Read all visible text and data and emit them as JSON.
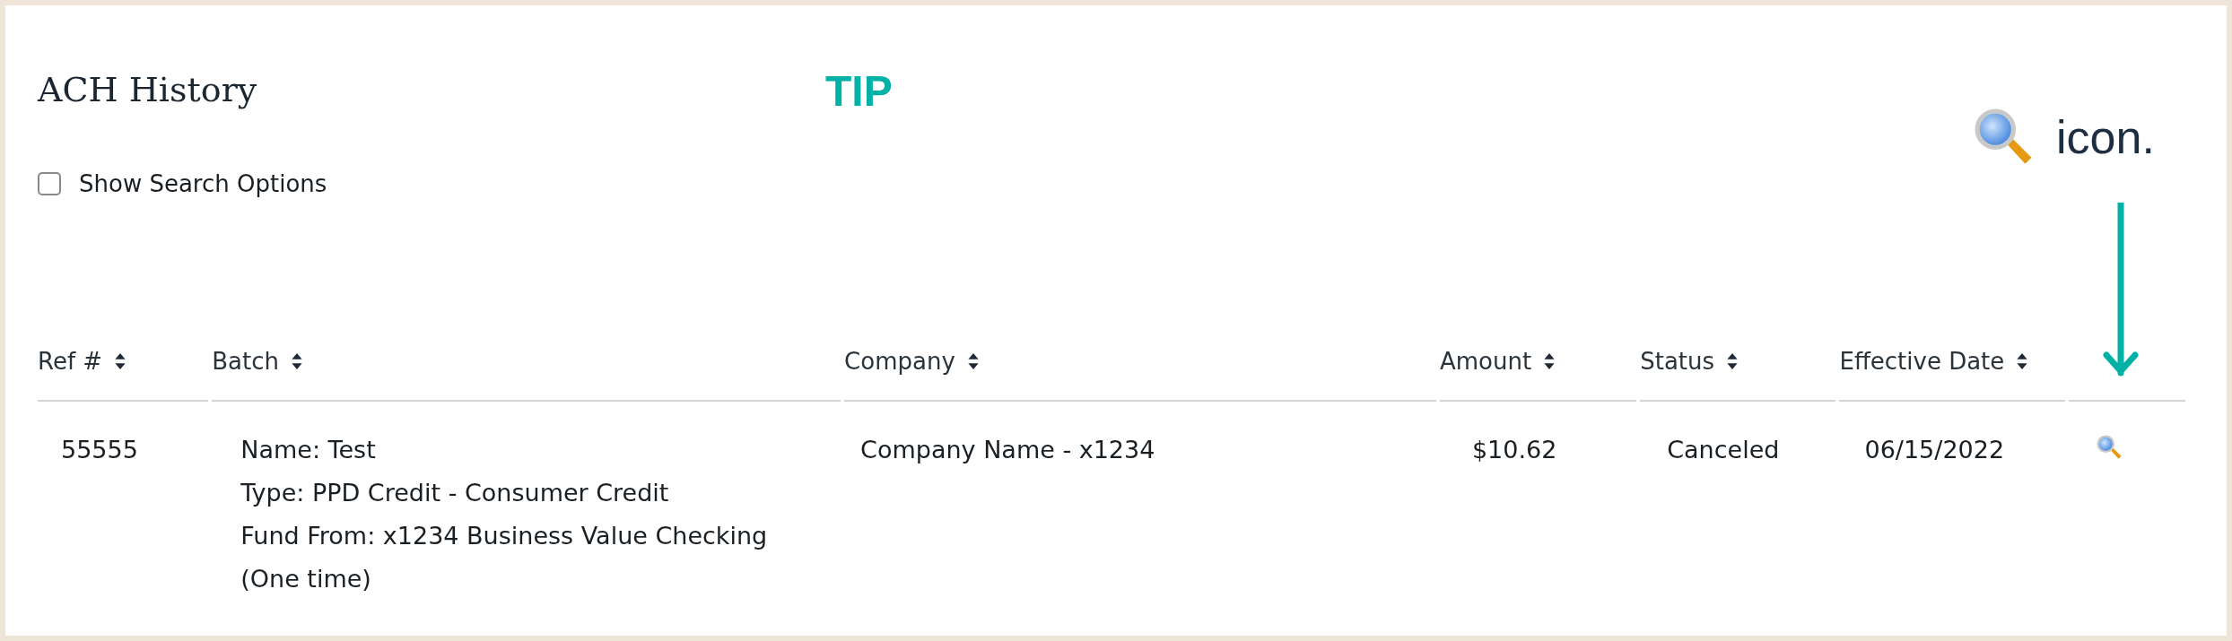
{
  "page": {
    "title": "ACH History"
  },
  "annotation": {
    "tip_label": "TIP",
    "callout_text": "icon."
  },
  "search_options": {
    "label": "Show Search Options",
    "checked": false
  },
  "table": {
    "columns": [
      {
        "label": "Ref #"
      },
      {
        "label": "Batch"
      },
      {
        "label": "Company"
      },
      {
        "label": "Amount"
      },
      {
        "label": "Status"
      },
      {
        "label": "Effective Date"
      }
    ],
    "rows": [
      {
        "ref": "55555",
        "batch_lines": [
          "Name: Test",
          "Type: PPD Credit - Consumer Credit",
          "Fund From: x1234 Business Value Checking",
          "(One time)"
        ],
        "company": "Company Name - x1234",
        "amount": "$10.62",
        "status": "Canceled",
        "effective_date": "06/15/2022"
      }
    ]
  }
}
